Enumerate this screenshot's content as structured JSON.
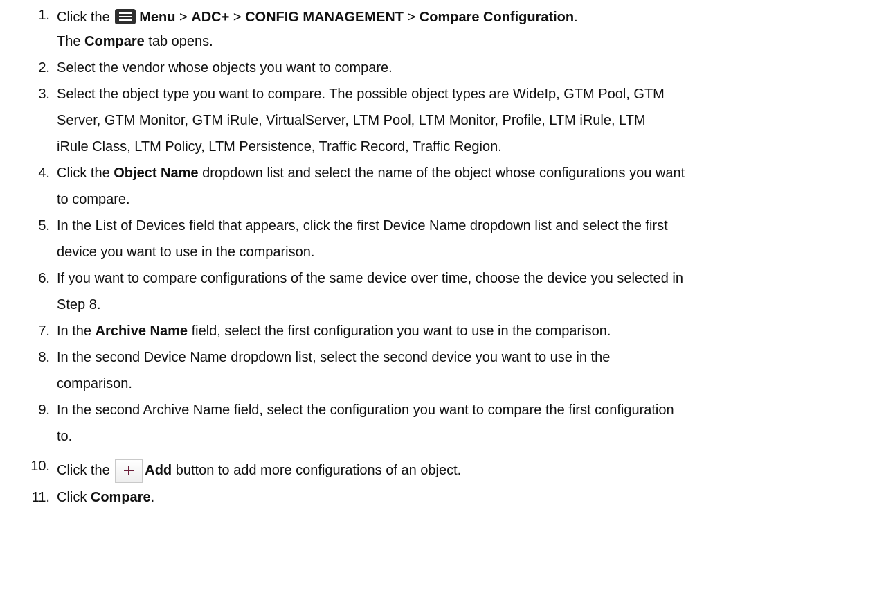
{
  "steps": [
    {
      "num": "1.",
      "line1": {
        "pre": "Click the",
        "menu": "Menu",
        "sep1": " > ",
        "adc": "ADC+",
        "sep2": " > ",
        "cfg": "CONFIG MANAGEMENT",
        "sep3": " > ",
        "cmp": "Compare Configuration",
        "post": "."
      },
      "line2": {
        "pre": "The ",
        "bold": "Compare",
        "post": " tab opens."
      }
    },
    {
      "num": "2.",
      "text": "Select the vendor whose objects you want to compare."
    },
    {
      "num": "3.",
      "lines": [
        "Select the object type you want to compare. The possible object types are WideIp, GTM Pool, GTM",
        "Server, GTM Monitor, GTM iRule, VirtualServer, LTM Pool, LTM Monitor, Profile, LTM iRule, LTM",
        "iRule Class, LTM Policy, LTM Persistence, Traffic Record, Traffic Region."
      ]
    },
    {
      "num": "4.",
      "pre": "Click the ",
      "bold": "Object Name",
      "post": " dropdown list and select the name of the object whose configurations you want",
      "line2": "to compare."
    },
    {
      "num": "5.",
      "lines": [
        "In the List of Devices field that appears, click the first Device Name dropdown list and select the first",
        "device you want to use in the comparison."
      ]
    },
    {
      "num": "6.",
      "lines": [
        "If you want to compare configurations of the same device over time, choose the device you selected in",
        "Step 8."
      ]
    },
    {
      "num": "7.",
      "pre": "In the ",
      "bold": "Archive Name",
      "post": " field, select the first configuration you want to use in the comparison."
    },
    {
      "num": "8.",
      "lines": [
        "In the second Device Name dropdown list, select the second device you want to use in the",
        "comparison."
      ]
    },
    {
      "num": "9.",
      "lines": [
        "In the second Archive Name field, select the configuration you want to compare the first configuration",
        "to."
      ]
    },
    {
      "num": "10.",
      "pre": "Click the",
      "bold": "Add",
      "post": " button to add more configurations of an object."
    },
    {
      "num": "11.",
      "pre": "Click ",
      "bold": "Compare",
      "post": "."
    }
  ],
  "icons": {
    "menu": "hamburger-menu-icon",
    "add": "plus-add-icon",
    "menu_color": "#2f2f2f",
    "add_plus_color": "#6b1f3a"
  }
}
